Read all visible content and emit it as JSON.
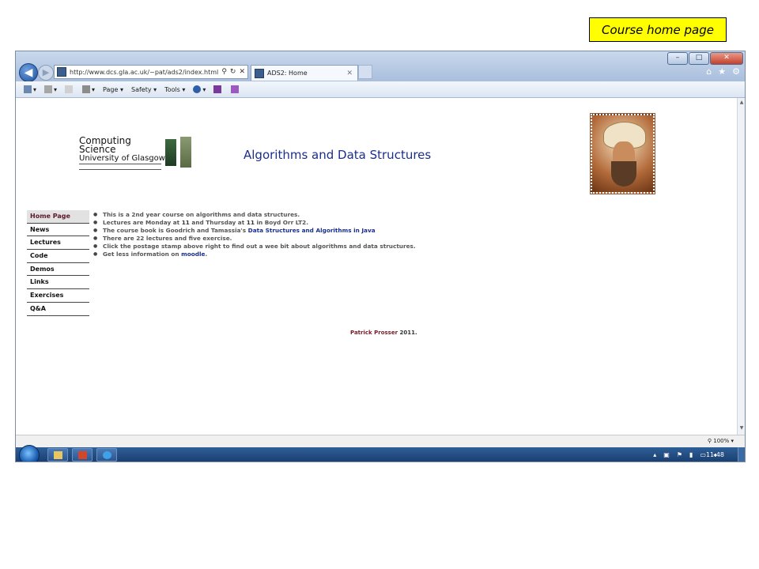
{
  "callout": {
    "text": "Course home page"
  },
  "browser": {
    "address_url": "http://www.dcs.gla.ac.uk/~pat/ads2/index.html",
    "tab_title": "ADS2: Home",
    "commands": {
      "page": "Page ▾",
      "safety": "Safety ▾",
      "tools": "Tools ▾"
    },
    "zoom": "100%",
    "clock": "11:48"
  },
  "page": {
    "logo": {
      "line1": "Computing",
      "line2": "Science",
      "line3": "University of Glasgow"
    },
    "title": "Algorithms and Data Structures",
    "nav": [
      "Home Page",
      "News",
      "Lectures",
      "Code",
      "Demos",
      "Links",
      "Exercises",
      "Q&A"
    ],
    "bullets": {
      "b1": "This is a 2nd year course on algorithms and data structures.",
      "b2_pre": "Lectures are Monday at ",
      "b2_t1": "11",
      "b2_mid": " and Thursday at ",
      "b2_t2": "11",
      "b2_post": " in Boyd Orr LT2.",
      "b3_pre": "The course book is Goodrich and Tamassia's ",
      "b3_link": "Data Structures and Algorithms in Java",
      "b4": "There are 22 lectures and five exercise.",
      "b5": "Click the postage stamp above right to find out a wee bit about algorithms and data structures.",
      "b6_pre": "Get less information on ",
      "b6_link": "moodle",
      "b6_post": "."
    },
    "footer": {
      "author": "Patrick Prosser",
      "year": " 2011."
    }
  }
}
